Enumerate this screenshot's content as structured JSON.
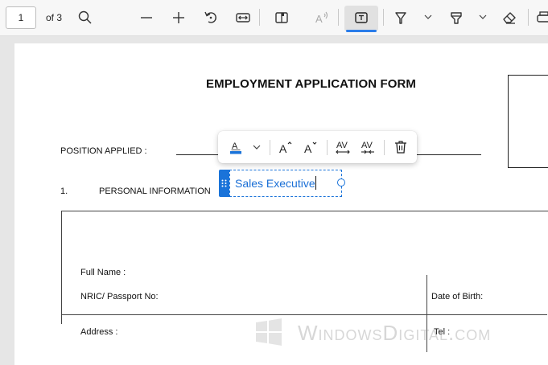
{
  "toolbar": {
    "page_number": "1",
    "page_total": "of 3",
    "icons": [
      "search-icon",
      "zoom-out-icon",
      "zoom-in-icon",
      "rotate-icon",
      "fit-width-icon",
      "page-view-icon",
      "read-aloud-icon",
      "add-text-icon",
      "draw-icon",
      "highlight-icon",
      "eraser-icon",
      "print-icon"
    ],
    "accent_color": "#2b7de9"
  },
  "document": {
    "title": "EMPLOYMENT APPLICATION FORM",
    "position_label": "POSITION APPLIED :",
    "section_number": "1.",
    "section_title": "PERSONAL INFORMATION",
    "table": {
      "full_name_label": "Full Name :",
      "nric_label": "NRIC/ Passport No:",
      "dob_label": "Date of Birth:",
      "address_label": "Address :",
      "tel_label": "Tel :"
    }
  },
  "text_box": {
    "value": "Sales Executive",
    "color": "#1a73d9"
  },
  "format_toolbar": {
    "buttons": [
      "text-color-icon",
      "chevron-down-icon",
      "increase-font-size-icon",
      "decrease-font-size-icon",
      "increase-spacing-icon",
      "decrease-spacing-icon",
      "delete-icon"
    ]
  },
  "watermark": {
    "text": "WindowsDigital.com"
  }
}
